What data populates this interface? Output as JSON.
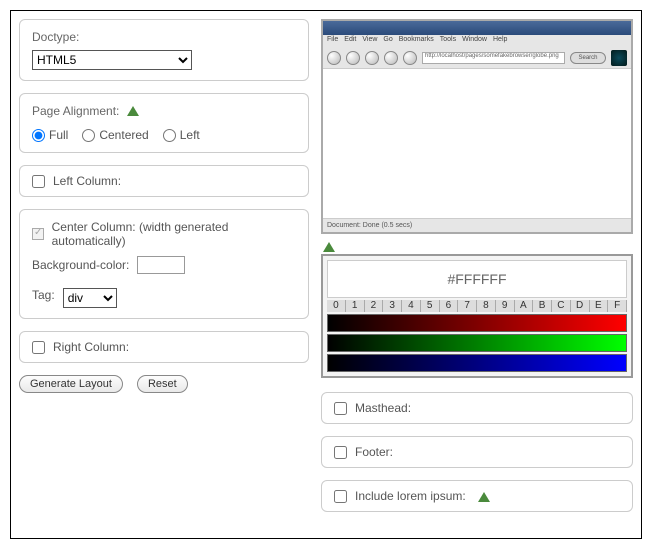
{
  "doctype": {
    "label": "Doctype:",
    "value": "HTML5"
  },
  "alignment": {
    "label": "Page Alignment:",
    "options": {
      "full": "Full",
      "centered": "Centered",
      "left": "Left"
    },
    "selected": "full"
  },
  "leftColumn": {
    "label": "Left Column:",
    "checked": false
  },
  "centerColumn": {
    "label": "Center Column: (width generated automatically)",
    "bg_label": "Background-color:",
    "bg_value": "",
    "tag_label": "Tag:",
    "tag_value": "div"
  },
  "rightColumn": {
    "label": "Right Column:",
    "checked": false
  },
  "buttons": {
    "generate": "Generate Layout",
    "reset": "Reset"
  },
  "browser": {
    "menus": [
      "File",
      "Edit",
      "View",
      "Go",
      "Bookmarks",
      "Tools",
      "Window",
      "Help"
    ],
    "url": "http://localhost/pages/somefakebrowser/globe.png",
    "search": "Search",
    "status": "Document: Done (0.5 secs)"
  },
  "picker": {
    "hex": "#FFFFFF",
    "digits": [
      "0",
      "1",
      "2",
      "3",
      "4",
      "5",
      "6",
      "7",
      "8",
      "9",
      "A",
      "B",
      "C",
      "D",
      "E",
      "F"
    ]
  },
  "masthead": {
    "label": "Masthead:",
    "checked": false
  },
  "footer": {
    "label": "Footer:",
    "checked": false
  },
  "lorem": {
    "label": "Include lorem ipsum:",
    "checked": false
  }
}
